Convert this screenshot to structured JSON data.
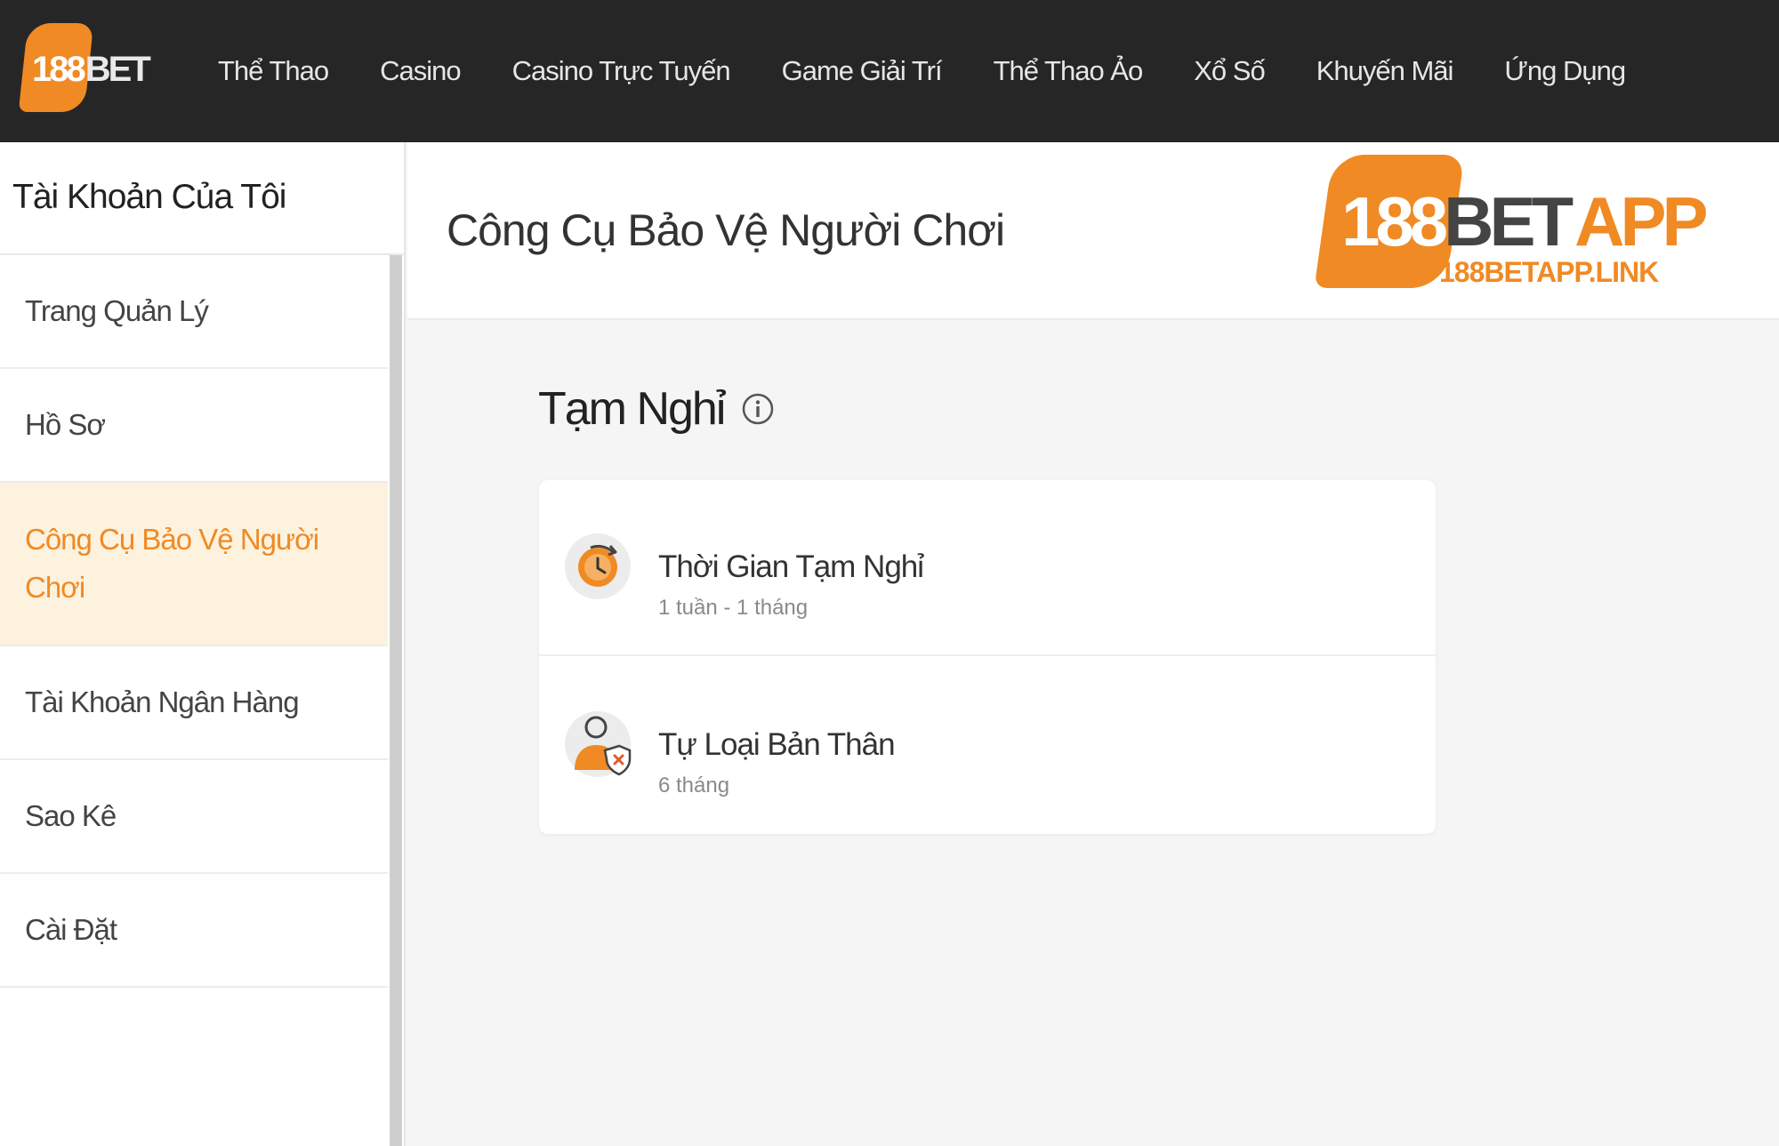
{
  "brand": {
    "logo_number": "188",
    "logo_suffix": "BET"
  },
  "nav": {
    "items": [
      "Thể Thao",
      "Casino",
      "Casino Trực Tuyến",
      "Game Giải Trí",
      "Thể Thao Ảo",
      "Xổ Số",
      "Khuyến Mãi",
      "Ứng Dụng"
    ]
  },
  "sidebar": {
    "title": "Tài Khoản Của Tôi",
    "items": [
      {
        "label": "Trang Quản Lý",
        "active": false
      },
      {
        "label": "Hồ Sơ",
        "active": false
      },
      {
        "label": "Công Cụ Bảo Vệ Người Chơi",
        "active": true
      },
      {
        "label": "Tài Khoản Ngân Hàng",
        "active": false
      },
      {
        "label": "Sao Kê",
        "active": false
      },
      {
        "label": "Cài Đặt",
        "active": false
      }
    ]
  },
  "main": {
    "page_title": "Công Cụ Bảo Vệ Người Chơi",
    "section_title": "Tạm Nghỉ",
    "options": [
      {
        "title": "Thời Gian Tạm Nghỉ",
        "subtitle": "1 tuần - 1 tháng",
        "icon": "timer-icon"
      },
      {
        "title": "Tự Loại Bản Thân",
        "subtitle": "6 tháng",
        "icon": "user-shield-icon"
      }
    ]
  },
  "watermark": {
    "num": "188",
    "bet": "BET",
    "app": "APP",
    "link": "188BETAPP.LINK"
  },
  "colors": {
    "accent": "#f08a24",
    "topbar": "#262626",
    "active_bg": "#fdf2de"
  }
}
